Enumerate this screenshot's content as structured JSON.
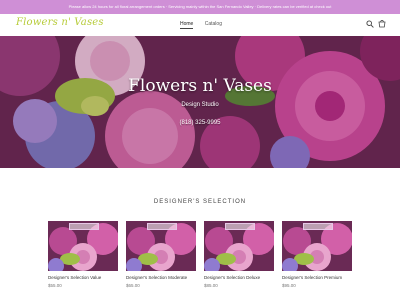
{
  "announcement": "Please allow 24 hours for all floral arrangement orders · Servicing mainly within the San Fernando Valley · Delivery rates can be verified at check out",
  "logo": "Flowers n' Vases",
  "nav": {
    "items": [
      "Home",
      "Catalog"
    ]
  },
  "hero": {
    "title": "Flowers n' Vases",
    "subtitle": "Design Studio",
    "phone": "(818) 325-9995"
  },
  "section_title": "DESIGNER'S SELECTION",
  "products": [
    {
      "name": "Designer's Selection Value",
      "price": "$55.00"
    },
    {
      "name": "Designer's Selection Moderate",
      "price": "$65.00"
    },
    {
      "name": "Designer's Selection Deluxe",
      "price": "$85.00"
    },
    {
      "name": "Designer's Selection Premium",
      "price": "$95.00"
    }
  ],
  "colors": {
    "announcement_bg": "#cf8fd6",
    "logo": "#b7cc3a"
  },
  "icons": [
    "search-icon",
    "cart-icon"
  ]
}
